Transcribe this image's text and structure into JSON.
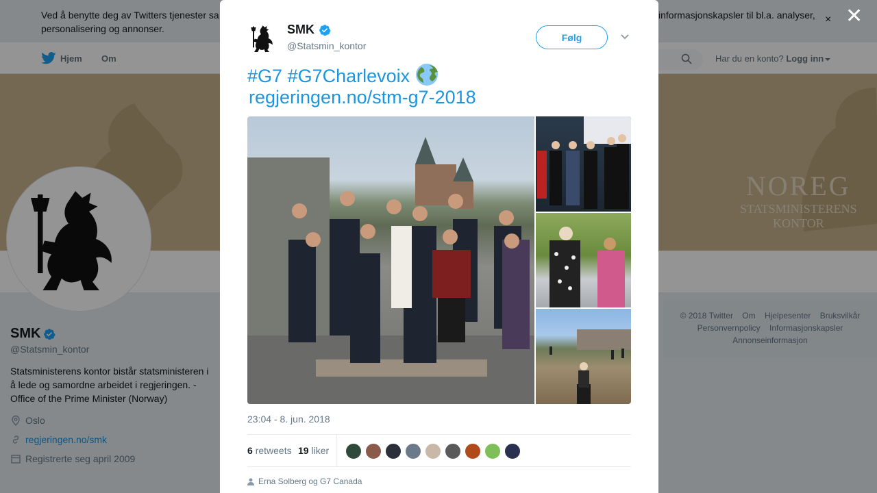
{
  "cookie_bar": {
    "text_left_line1": "Ved å benytte deg av Twitters tjenester sa",
    "text_left_line2": "personalisering og annonser.",
    "text_right": "informasjonskapsler til bl.a. analyser,",
    "close_glyph": "×"
  },
  "topnav": {
    "home_label": "Hjem",
    "about_label": "Om",
    "account_prompt": "Har du en konto?",
    "login_label": "Logg inn"
  },
  "banner": {
    "stamp_line1": "NOREG",
    "stamp_line2": "STATSMINISTERENS",
    "stamp_line3": "KONTOR"
  },
  "profile": {
    "name": "SMK",
    "handle": "@Statsmin_kontor",
    "bio": "Statsministerens kontor bistår statsministeren i å lede og samordne arbeidet i regjeringen. - Office of the Prime Minister (Norway)",
    "location": "Oslo",
    "website": "regjeringen.no/smk",
    "joined": "Registrerte seg april 2009"
  },
  "footer": {
    "copyright": "© 2018 Twitter",
    "about": "Om",
    "help": "Hjelpesenter",
    "terms": "Bruksvilkår",
    "privacy": "Personvernpolicy",
    "cookies": "Informasjonskapsler",
    "ads": "Annonseinformasjon"
  },
  "overlay": {
    "close_glyph": "✕"
  },
  "tweet": {
    "author_name": "SMK",
    "author_handle": "@Statsmin_kontor",
    "follow_label": "Følg",
    "hashtag1": "#G7",
    "hashtag2": "#G7Charlevoix",
    "link": "regjeringen.no/stm-g7-2018",
    "timestamp": "23:04 - 8. jun. 2018",
    "retweets_count": "6",
    "retweets_label": "retweets",
    "likes_count": "19",
    "likes_label": "liker",
    "tagged": "Erna Solberg og G7 Canada"
  },
  "colors": {
    "brand_blue": "#1da1f2",
    "link_blue": "#1b95e0",
    "verified_blue": "#1da1f2"
  },
  "icons": [
    "twitter-bird-icon",
    "search-icon",
    "verified-icon",
    "chevron-down-icon",
    "globe-emoji-icon",
    "location-icon",
    "link-icon",
    "calendar-icon",
    "person-icon",
    "close-icon"
  ]
}
